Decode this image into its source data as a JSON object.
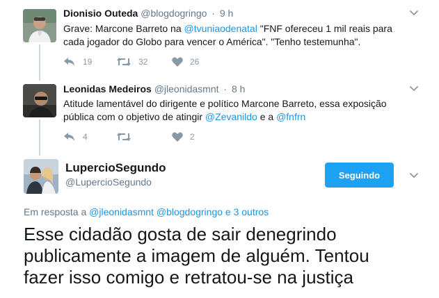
{
  "tweets": [
    {
      "name": "Dionisio Outeda",
      "handle": "@blogdogringo",
      "dot": "·",
      "time": "9 h",
      "text_parts": [
        "Grave: Marcone Barreto na ",
        "@tvuniaodenatal",
        " \"FNF ofereceu 1 mil reais para cada jogador do Globo para vencer o América\". \"Tenho testemunha\"."
      ],
      "replies": "19",
      "retweets": "32",
      "likes": "26"
    },
    {
      "name": "Leonidas Medeiros",
      "handle": "@jleonidasmnt",
      "dot": "·",
      "time": "8 h",
      "text_parts": [
        "Atitude lamentável do dirigente e político Marcone Barreto, essa exposição pública com o objetivo de atingir ",
        "@Zevanildo",
        " e a ",
        "@fnfrn"
      ],
      "replies": "4",
      "retweets": "",
      "likes": "2"
    }
  ],
  "main_tweet": {
    "name": "LupercioSegundo",
    "handle": "@LupercioSegundo",
    "follow_label": "Seguindo",
    "reply_prefix": "Em resposta a ",
    "reply_mentions": "@jleonidasmnt @blogdogringo",
    "reply_suffix": " e 3 outros",
    "text": "Esse cidadão gosta de sair denegrindo publicamente a imagem de alguém. Tentou fazer isso comigo e retratou-se na justiça"
  },
  "icons": {
    "reply": "reply-icon",
    "retweet": "retweet-icon",
    "like": "heart-icon",
    "menu": "chevron-down-icon"
  },
  "colors": {
    "link": "#1b95e0",
    "button": "#1da1f2",
    "muted": "#657786",
    "action": "#8899a6"
  }
}
